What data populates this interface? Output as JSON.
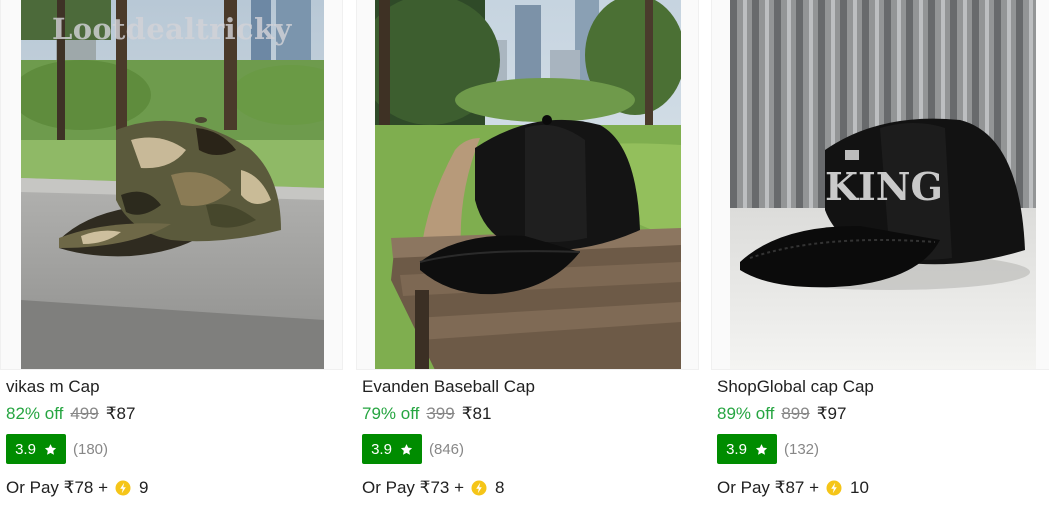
{
  "watermark": "Lootdealtricky",
  "currency_symbol": "₹",
  "products": [
    {
      "title": "vikas m Cap",
      "discount": "82% off",
      "mrp": "499",
      "price": "₹87",
      "rating": "3.9",
      "reviews": "(180)",
      "pay_prefix": "Or Pay ₹78 +",
      "coins": "9",
      "image_icon": "camo-cap-photo"
    },
    {
      "title": "Evanden Baseball Cap",
      "discount": "79% off",
      "mrp": "399",
      "price": "₹81",
      "rating": "3.9",
      "reviews": "(846)",
      "pay_prefix": "Or Pay ₹73 +",
      "coins": "8",
      "image_icon": "black-cap-photo"
    },
    {
      "title": "ShopGlobal cap Cap",
      "discount": "89% off",
      "mrp": "899",
      "price": "₹97",
      "rating": "3.9",
      "reviews": "(132)",
      "pay_prefix": "Or Pay ₹87 +",
      "coins": "10",
      "image_icon": "king-cap-photo",
      "image_text": "KING"
    }
  ],
  "colors": {
    "discount_green": "#26a541",
    "rating_badge": "#008c00",
    "strike_gray": "#878787",
    "coin_gold": "#f5c518"
  }
}
